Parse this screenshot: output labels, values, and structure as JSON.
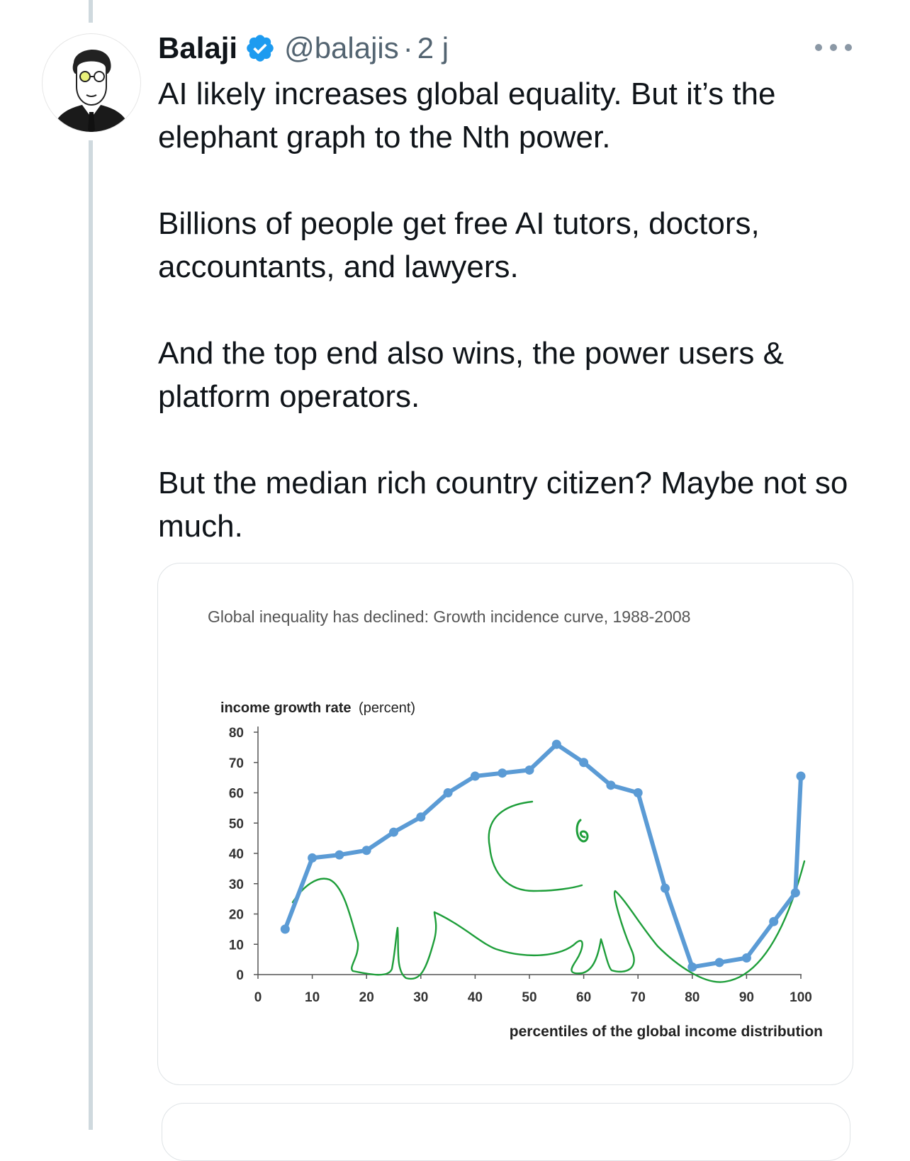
{
  "tweet": {
    "author_name": "Balaji",
    "handle": "@balajis",
    "separator": "·",
    "time": "2 j",
    "verified": true,
    "avatar_icon": "avatar-sketch-icon",
    "more_icon": "more-dots-icon",
    "paragraphs": [
      "AI likely increases global equality. But it’s the elephant graph to the Nth power.",
      "Billions of people get free AI tutors, doctors, accountants, and lawyers.",
      "And the top end also wins, the power users & platform operators.",
      "But the median rich country citizen? Maybe not so much."
    ]
  },
  "colors": {
    "series_line": "#5b9bd5",
    "annotation": "#1e9e3a",
    "verified_badge": "#1d9bf0",
    "thread_line": "#cfd9de"
  },
  "chart_data": {
    "type": "line",
    "title": "Global inequality has declined: Growth incidence curve, 1988-2008",
    "ylabel_bold": "income growth rate",
    "ylabel_unit": "(percent)",
    "xlabel": "percentiles of the global income distribution",
    "xlim": [
      0,
      100
    ],
    "ylim": [
      0,
      80
    ],
    "xticks": [
      0,
      10,
      20,
      30,
      40,
      50,
      60,
      70,
      80,
      90,
      100
    ],
    "yticks": [
      0,
      10,
      20,
      30,
      40,
      50,
      60,
      70,
      80
    ],
    "grid": false,
    "legend": "none",
    "series": [
      {
        "x": [
          5,
          10,
          15,
          20,
          25,
          30,
          35,
          40,
          45,
          50,
          55,
          60,
          65,
          70,
          75,
          80,
          85,
          90,
          95,
          99,
          100
        ],
        "y": [
          15,
          38.5,
          39.5,
          41,
          47,
          52,
          60,
          65.5,
          66.5,
          67.5,
          76,
          70,
          62.5,
          60,
          28.5,
          2.5,
          4,
          5.5,
          17.5,
          27,
          65.5
        ]
      }
    ],
    "annotation": "hand-drawn elephant outline"
  }
}
